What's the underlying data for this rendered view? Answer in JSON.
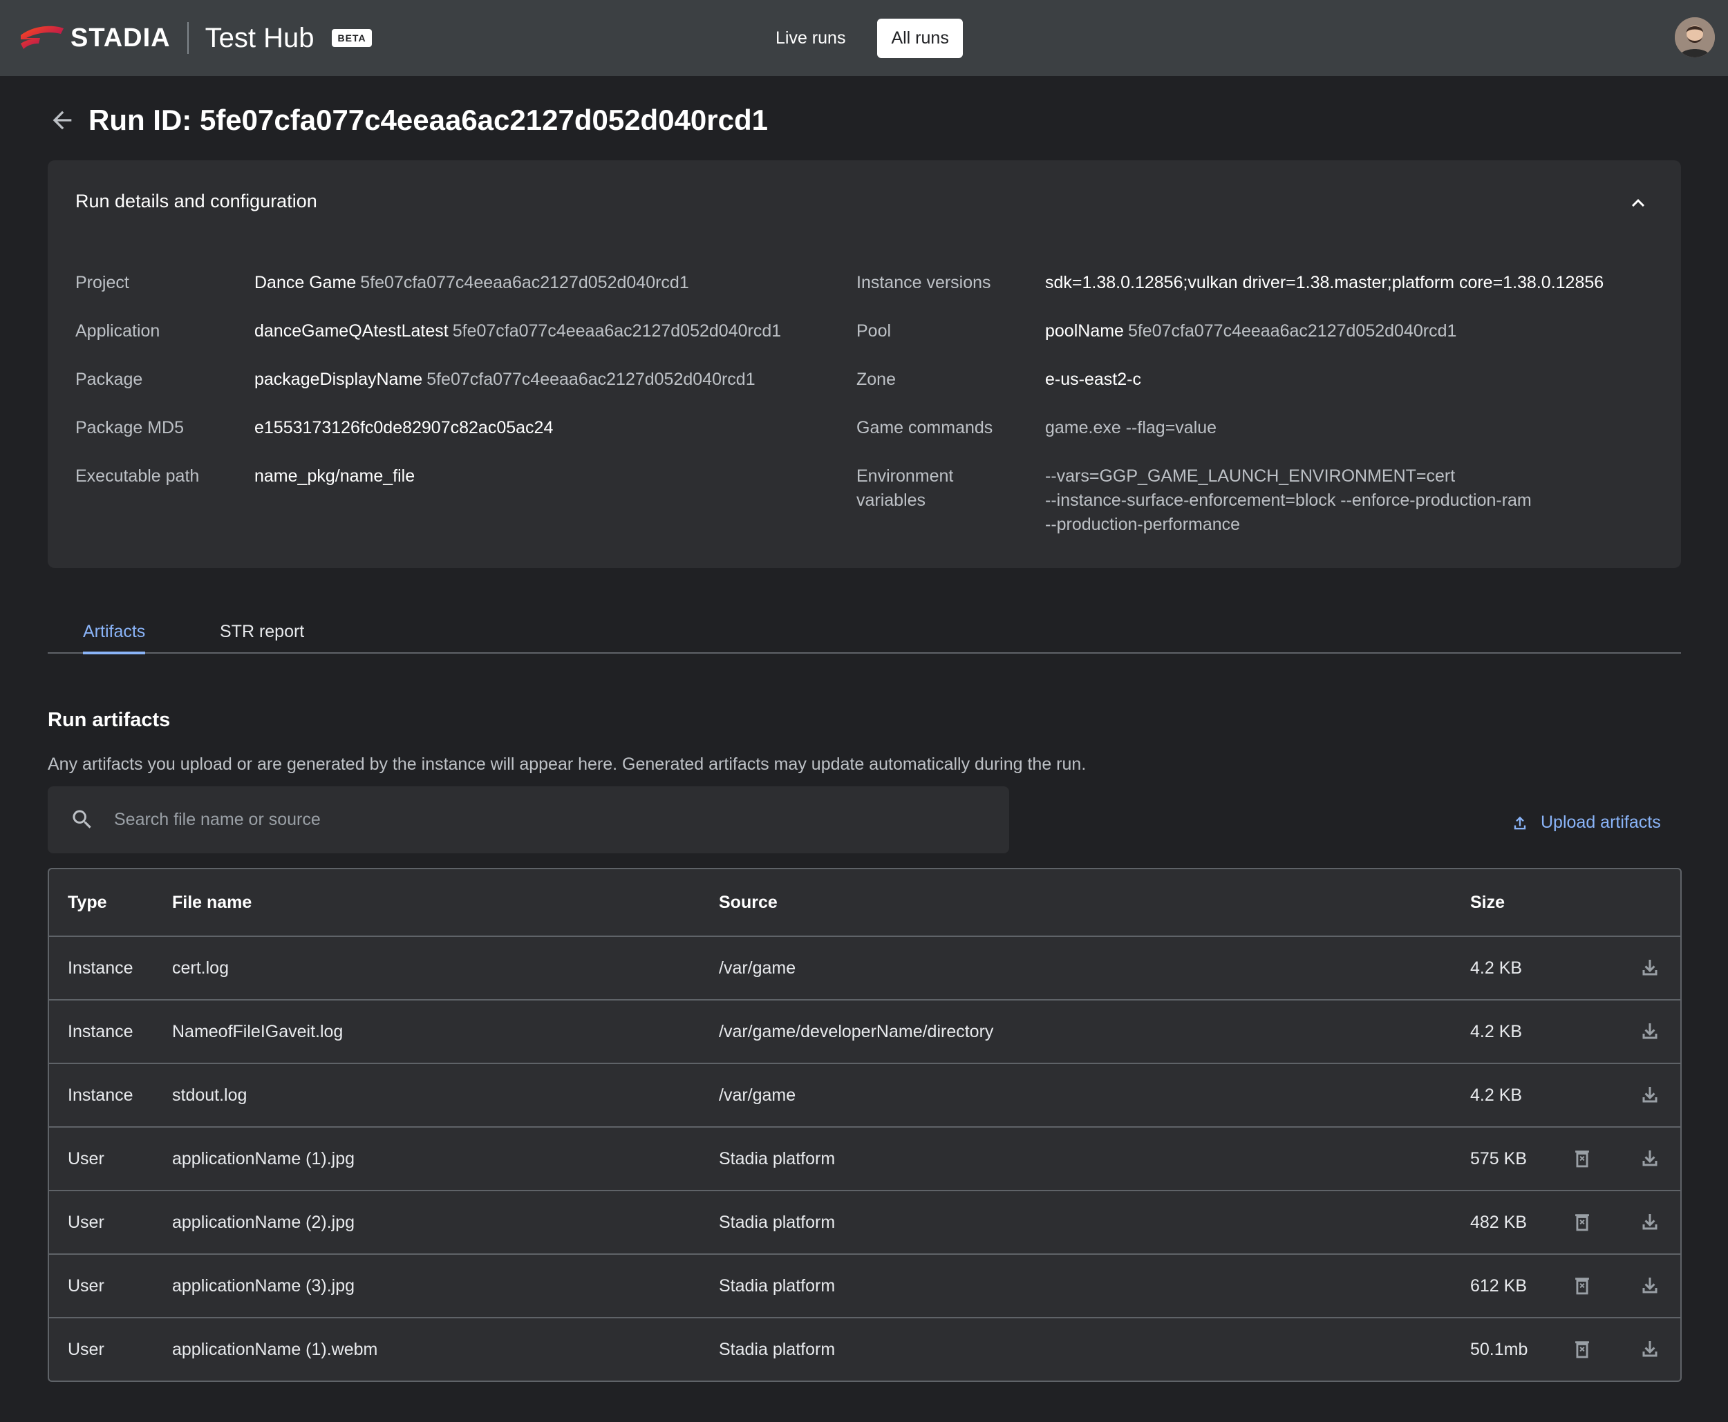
{
  "topbar": {
    "logo_text": "STADIA",
    "app_name": "Test Hub",
    "badge": "BETA",
    "nav": {
      "live_runs": "Live runs",
      "all_runs": "All runs"
    }
  },
  "page": {
    "title": "Run ID: 5fe07cfa077c4eeaa6ac2127d052d040rcd1"
  },
  "details": {
    "title": "Run details and configuration",
    "left": [
      {
        "label": "Project",
        "value": "Dance Game",
        "sub": "5fe07cfa077c4eeaa6ac2127d052d040rcd1"
      },
      {
        "label": "Application",
        "value": "danceGameQAtestLatest",
        "sub": "5fe07cfa077c4eeaa6ac2127d052d040rcd1"
      },
      {
        "label": "Package",
        "value": "packageDisplayName",
        "sub": "5fe07cfa077c4eeaa6ac2127d052d040rcd1"
      },
      {
        "label": "Package MD5",
        "value": "e1553173126fc0de82907c82ac05ac24",
        "sub": ""
      },
      {
        "label": "Executable path",
        "value": "name_pkg/name_file",
        "sub": ""
      }
    ],
    "right": [
      {
        "label": "Instance versions",
        "value": "sdk=1.38.0.12856;vulkan driver=1.38.master;platform core=1.38.0.12856",
        "sub": ""
      },
      {
        "label": "Pool",
        "value": "poolName",
        "sub": "5fe07cfa077c4eeaa6ac2127d052d040rcd1"
      },
      {
        "label": "Zone",
        "value": "e-us-east2-c",
        "sub": ""
      },
      {
        "label": "Game commands",
        "value": "",
        "sub": "game.exe --flag=value"
      },
      {
        "label_line1": "Environment",
        "label_line2": "variables",
        "line1": "--vars=GGP_GAME_LAUNCH_ENVIRONMENT=cert",
        "line2": "--instance-surface-enforcement=block --enforce-production-ram",
        "line3": "--production-performance"
      }
    ]
  },
  "tabs": [
    {
      "label": "Artifacts",
      "active": true
    },
    {
      "label": "STR report",
      "active": false
    }
  ],
  "artifacts": {
    "title": "Run artifacts",
    "description": "Any artifacts you upload or are generated by the instance will appear here. Generated artifacts may update automatically during the run.",
    "search_placeholder": "Search file name or source",
    "upload_label": "Upload artifacts",
    "columns": {
      "type": "Type",
      "file_name": "File name",
      "source": "Source",
      "size": "Size"
    },
    "rows": [
      {
        "type": "Instance",
        "file_name": "cert.log",
        "source": "/var/game",
        "size": "4.2 KB",
        "deletable": false
      },
      {
        "type": "Instance",
        "file_name": "NameofFileIGaveit.log",
        "source": "/var/game/developerName/directory",
        "size": "4.2 KB",
        "deletable": false
      },
      {
        "type": "Instance",
        "file_name": "stdout.log",
        "source": "/var/game",
        "size": "4.2 KB",
        "deletable": false
      },
      {
        "type": "User",
        "file_name": "applicationName (1).jpg",
        "source": "Stadia platform",
        "size": "575 KB",
        "deletable": true
      },
      {
        "type": "User",
        "file_name": "applicationName (2).jpg",
        "source": "Stadia platform",
        "size": "482 KB",
        "deletable": true
      },
      {
        "type": "User",
        "file_name": "applicationName (3).jpg",
        "source": "Stadia platform",
        "size": "612 KB",
        "deletable": true
      },
      {
        "type": "User",
        "file_name": "applicationName (1).webm",
        "source": "Stadia platform",
        "size": "50.1mb",
        "deletable": true
      }
    ]
  },
  "colors": {
    "background": "#202124",
    "topbar": "#3c4043",
    "panel": "#2d2e31",
    "accent": "#8ab4f8",
    "logo": "#ff4c1d"
  }
}
